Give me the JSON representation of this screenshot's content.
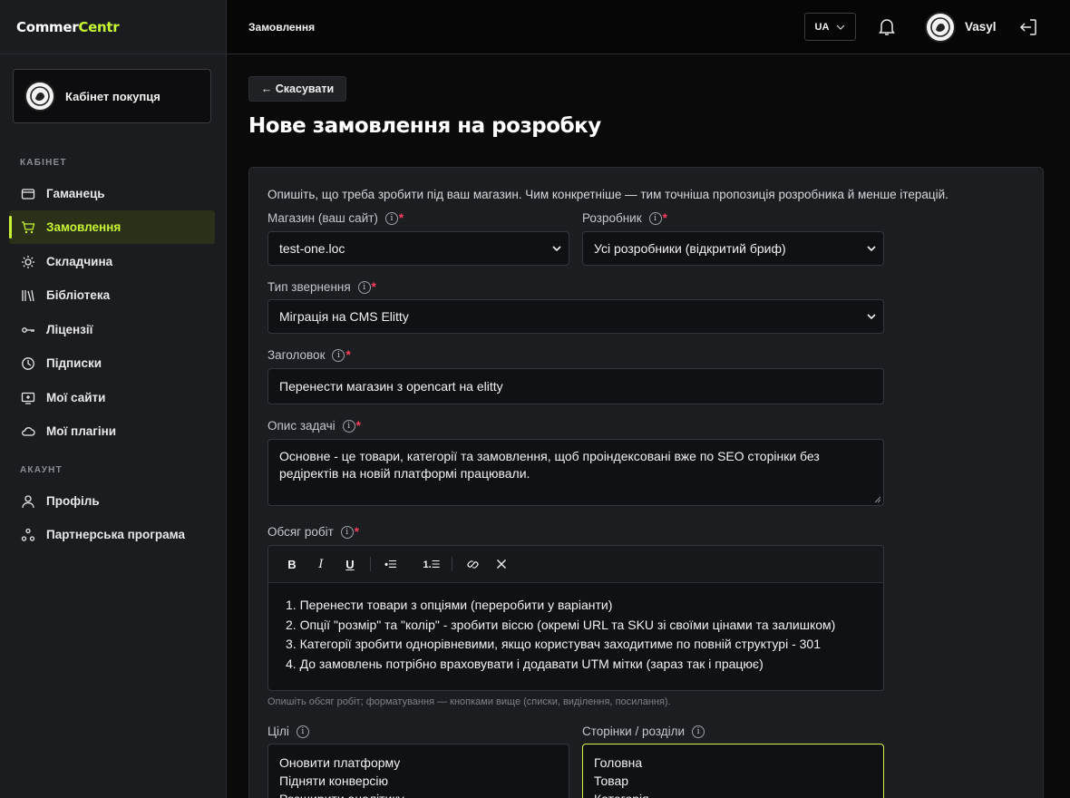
{
  "brand": {
    "name_a": "Commer",
    "name_b": "Centr"
  },
  "sidebar": {
    "cabinet_label": "Кабінет покупця",
    "section_cabinet": "КАБІНЕТ",
    "section_account": "АКАУНТ",
    "items": [
      {
        "label": "Гаманець",
        "icon": "wallet-icon"
      },
      {
        "label": "Замовлення",
        "icon": "cart-icon",
        "active": true
      },
      {
        "label": "Складчина",
        "icon": "sun-icon"
      },
      {
        "label": "Бібліотека",
        "icon": "library-icon"
      },
      {
        "label": "Ліцензії",
        "icon": "key-icon"
      },
      {
        "label": "Підписки",
        "icon": "clock-icon"
      },
      {
        "label": "Мої сайти",
        "icon": "monitor-icon"
      },
      {
        "label": "Мої плагіни",
        "icon": "cloud-icon"
      }
    ],
    "account_items": [
      {
        "label": "Профіль",
        "icon": "user-icon"
      },
      {
        "label": "Партнерська програма",
        "icon": "network-icon"
      }
    ]
  },
  "topbar": {
    "breadcrumb": "Замовлення",
    "language": "UA",
    "user_name": "Vasyl"
  },
  "page": {
    "cancel_label": "← Скасувати",
    "title": "Нове замовлення на розробку",
    "intro": "Опишіть, що треба зробити під ваш магазин. Чим конкретніше — тим точніша пропозиція розробника й менше ітерацій."
  },
  "form": {
    "shop_label": "Магазин (ваш сайт)",
    "shop_value": "test-one.loc",
    "developer_label": "Розробник",
    "developer_value": "Усі розробники (відкритий бриф)",
    "type_label": "Тип звернення",
    "type_value": "Міграція на CMS Elitty",
    "title_label": "Заголовок",
    "title_value": "Перенести магазин з opencart на elitty",
    "description_label": "Опис задачі",
    "description_line1": "Основне - це товари, категорії та замовлення, щоб проіндексовані вже по SEO сторінки без",
    "description_line2": "редіректів на новій платформі працювали.",
    "scope_label": "Обсяг робіт",
    "scope_items": [
      "1. Перенести товари з опціями (переробити у варіанти)",
      "2. Опції \"розмір\" та \"колір\" - зробити віссю (окремі URL та SKU зі своїми цінами та залишком)",
      "3. Категорії зробити однорівневими, якщо користувач заходитиме по повній структурі - 301",
      "4. До замовлень потрібно враховувати і додавати UTM мітки (зараз так і працює)"
    ],
    "scope_hint": "Опишіть обсяг робіт; форматування — кнопками вище (списки, виділення, посилання).",
    "goals_label": "Цілі",
    "goals_lines": [
      "Оновити платформу",
      "Підняти конверсію",
      "Розширити аналітику"
    ],
    "pages_label": "Сторінки / розділи",
    "pages_lines": [
      "Головна",
      "Товар",
      "Категорія"
    ],
    "toolbar": {
      "bold": "B",
      "italic": "I",
      "underline": "U",
      "bullets": "•☰",
      "numbered": "1.☰"
    }
  },
  "colors": {
    "accent": "#c6f432",
    "required": "#ff3d5a",
    "panel": "#1b1d21"
  }
}
